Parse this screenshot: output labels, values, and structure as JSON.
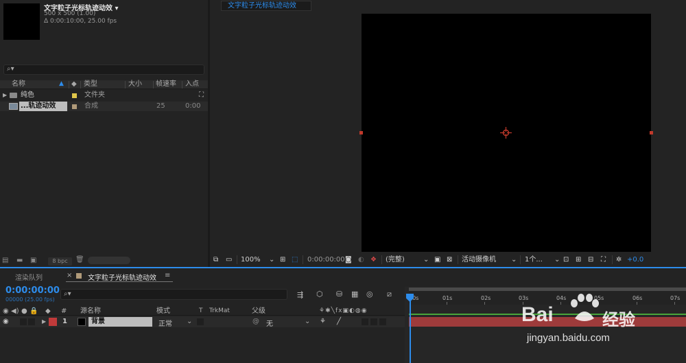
{
  "project": {
    "comp_name": "文字粒子光标轨迹动效",
    "dropdown_icon": "triangle-down",
    "meta_size": "500 x 500 (1.00)",
    "meta_duration": "Δ 0:00:10:00, 25.00 fps",
    "search_icon": "search-icon",
    "columns": [
      "名称",
      "类型",
      "大小",
      "帧速率",
      "入点"
    ],
    "items": [
      {
        "name": "纯色",
        "type": "文件夹",
        "fps": "",
        "in": "",
        "icon": "folder-icon",
        "label_color": "#e0c64a"
      },
      {
        "name": "...轨迹动效",
        "type": "合成",
        "fps": "25",
        "in": "0:00",
        "icon": "composition-icon",
        "label_color": "#b09a79"
      }
    ],
    "bpc": "8 bpc"
  },
  "viewer": {
    "tab_title": "文字粒子光标轨迹动效",
    "zoom": "100%",
    "timecode": "0:00:00:00",
    "resolution": "(完整)",
    "camera": "活动摄像机",
    "views": "1个...",
    "exposure": "+0.0"
  },
  "timeline": {
    "render_queue_tab": "渲染队列",
    "comp_tab": "文字粒子光标轨迹动效",
    "close_icon": "×",
    "menu_icon": "≡",
    "current_time": "0:00:00:00",
    "current_frame": "00000 (25.00 fps)",
    "columns": {
      "number": "#",
      "source_name": "源名称",
      "mode": "模式",
      "t": "T",
      "trkmat": "TrkMat",
      "parent": "父级"
    },
    "layers": [
      {
        "number": "1",
        "name": "背景",
        "mode": "正常",
        "parent": "无",
        "label_color": "#c03a3a"
      }
    ],
    "ruler_labels": [
      "00s",
      "01s",
      "02s",
      "03s",
      "04s",
      "05s",
      "06s",
      "07s"
    ]
  },
  "watermark": {
    "brand": "Bai",
    "brand_cn": "经验",
    "url": "jingyan.baidu.com"
  },
  "colors": {
    "accent": "#2d8ceb",
    "layer_bar": "#9e3b3b",
    "handle": "#c0392b"
  }
}
